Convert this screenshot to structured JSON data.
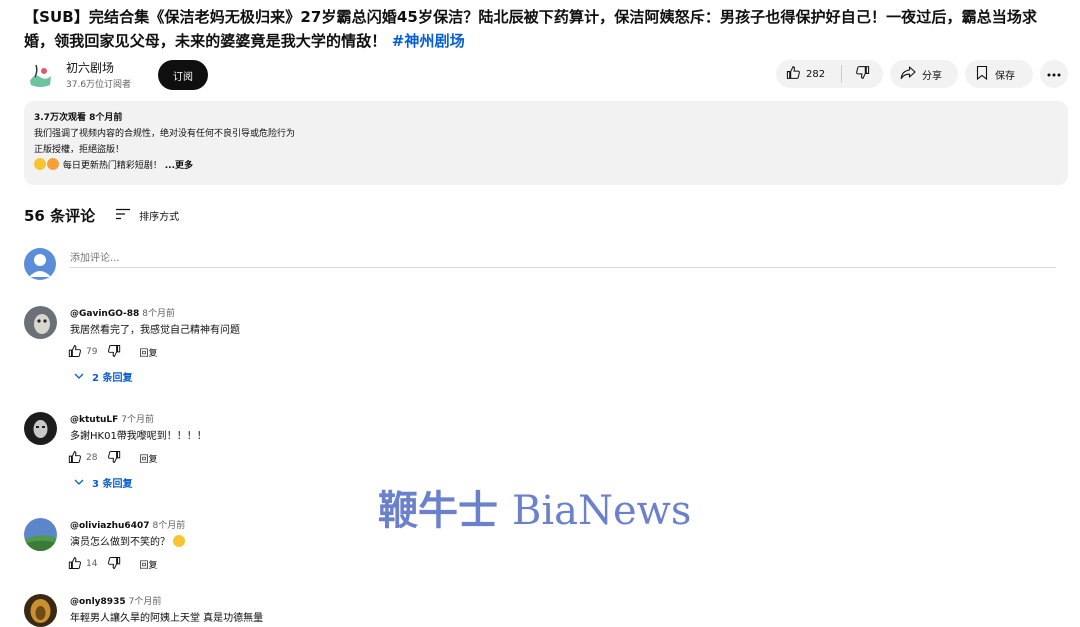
{
  "video": {
    "title_main": "【SUB】完结合集《保洁老妈无极归来》27岁霸总闪婚45岁保洁？陆北辰被下药算计，保洁阿姨怒斥：男孩子也得保护好自己！一夜过后，霸总当场求婚，领我回家见父母，未来的婆婆竟是我大学的情敌！",
    "title_hashtag": "#神州剧场"
  },
  "channel": {
    "name": "初六剧场",
    "subscribers": "37.6万位订阅者",
    "subscribe_label": "订阅"
  },
  "actions": {
    "like_count": "282",
    "share_label": "分享",
    "save_label": "保存"
  },
  "description": {
    "meta": "3.7万次观看  8个月前",
    "line1": "我们强调了视频内容的合规性，绝对没有任何不良引导或危险行为",
    "line2": "正版授權，拒絕盜版！",
    "line3": "每日更新热门精彩短剧！",
    "more": "...更多"
  },
  "comments_section": {
    "count_label": "56 条评论",
    "sort_label": "排序方式",
    "add_placeholder": "添加评论..."
  },
  "comments": [
    {
      "author": "@GavinGO-88",
      "time": "8个月前",
      "text": "我居然看完了，我感觉自己精神有问题",
      "likes": "79",
      "reply_label": "回复",
      "replies_label": "2 条回复"
    },
    {
      "author": "@ktutuLF",
      "time": "7个月前",
      "text": "多謝HK01帶我嚟呢到！！！！",
      "likes": "28",
      "reply_label": "回复",
      "replies_label": "3 条回复"
    },
    {
      "author": "@oliviazhu6407",
      "time": "8个月前",
      "text": "演员怎么做到不笑的？",
      "likes": "14",
      "reply_label": "回复"
    },
    {
      "author": "@only8935",
      "time": "7个月前",
      "text": "年輕男人讓久旱的阿姨上天堂 真是功德無量"
    }
  ],
  "watermark": {
    "cn": "鞭牛士",
    "en": "BiaNews"
  },
  "colors": {
    "link_blue": "#065fd4",
    "pill_gray": "#f2f2f2",
    "watermark": "#425ebe"
  }
}
